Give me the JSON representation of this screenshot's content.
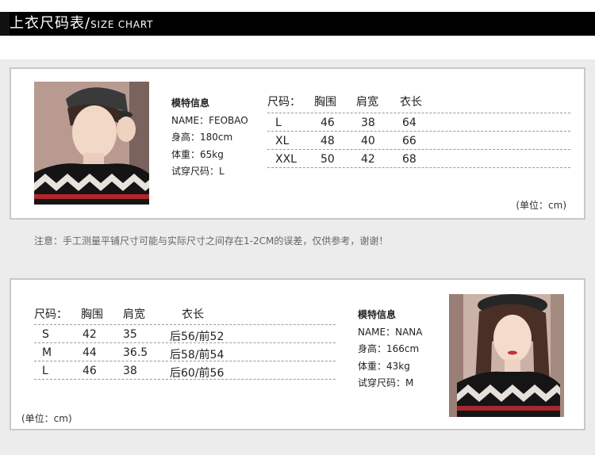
{
  "header": {
    "title_zh": "上衣尺码表/",
    "title_en": "SIZE CHART"
  },
  "male": {
    "photo_icon": "male-model-photo",
    "info": {
      "heading": "模特信息",
      "name": "NAME：FEOBAO",
      "height": "身高：180cm",
      "weight": "体重：65kg",
      "tried_size": "试穿尺码：L"
    },
    "table": {
      "headers": [
        "尺码：",
        "胸围",
        "肩宽",
        "衣长"
      ],
      "rows": [
        [
          "L",
          "46",
          "38",
          "64"
        ],
        [
          "XL",
          "48",
          "40",
          "66"
        ],
        [
          "XXL",
          "50",
          "42",
          "68"
        ]
      ]
    },
    "unit": "(单位：cm)"
  },
  "note": "注意：手工测量平铺尺寸可能与实际尺寸之间存在1-2CM的误差，仅供参考，谢谢！",
  "female": {
    "photo_icon": "female-model-photo",
    "info": {
      "heading": "模特信息",
      "name": "NAME：NANA",
      "height": "身高：166cm",
      "weight": "体重：43kg",
      "tried_size": "试穿尺码：M"
    },
    "table": {
      "headers": [
        "尺码：",
        "胸围",
        "肩宽",
        "衣长"
      ],
      "rows": [
        [
          "S",
          "42",
          "35",
          "后56/前52"
        ],
        [
          "M",
          "44",
          "36.5",
          "后58/前54"
        ],
        [
          "L",
          "46",
          "38",
          "后60/前56"
        ]
      ]
    },
    "unit": "(单位：cm)"
  }
}
